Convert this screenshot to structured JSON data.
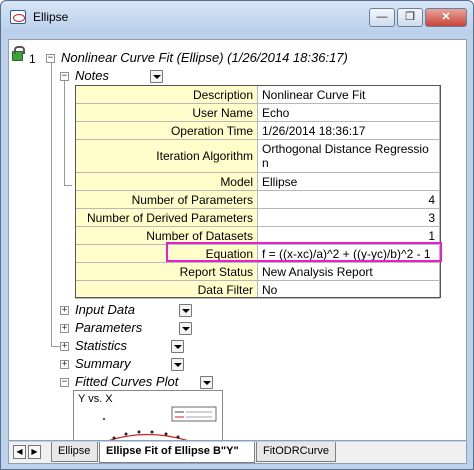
{
  "window": {
    "title": "Ellipse",
    "min_glyph": "—",
    "max_glyph": "❐",
    "close_glyph": "✕"
  },
  "tree": {
    "index": "1",
    "root_title": "Nonlinear Curve Fit (Ellipse) (1/26/2014 18:36:17)",
    "expand_glyph": "+",
    "collapse_glyph": "−",
    "notes_label": "Notes",
    "notes_rows": [
      {
        "label": "Description",
        "value": "Nonlinear Curve Fit"
      },
      {
        "label": "User Name",
        "value": "Echo"
      },
      {
        "label": "Operation Time",
        "value": "1/26/2014 18:36:17"
      },
      {
        "label": "Iteration Algorithm",
        "value": "Orthogonal Distance Regressio\nn"
      },
      {
        "label": "Model",
        "value": "Ellipse"
      },
      {
        "label": "Number of Parameters",
        "value": "4"
      },
      {
        "label": "Number of Derived Parameters",
        "value": "3"
      },
      {
        "label": "Number of Datasets",
        "value": "1"
      },
      {
        "label": "Equation",
        "value": "f = ((x-xc)/a)^2 + ((y-yc)/b)^2 - 1"
      },
      {
        "label": "Report Status",
        "value": "New Analysis Report"
      },
      {
        "label": "Data Filter",
        "value": "No"
      }
    ],
    "sections": [
      "Input Data",
      "Parameters",
      "Statistics",
      "Summary"
    ],
    "fitted_label": "Fitted Curves Plot",
    "graph_title": "Y vs. X"
  },
  "tabs": [
    {
      "label": "Ellipse",
      "active": false
    },
    {
      "label": "Ellipse Fit of Ellipse B\"Y\"",
      "active": true
    },
    {
      "label": "FitODRCurve",
      "active": false
    }
  ],
  "nav": {
    "prev_glyph": "◀",
    "next_glyph": "▶"
  },
  "colors": {
    "highlight": "#e81fd0",
    "label_bg": "#fffecb",
    "accent": "#3ca23c"
  }
}
